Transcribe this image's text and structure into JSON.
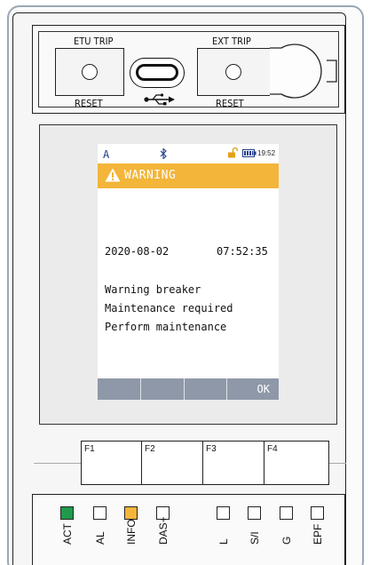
{
  "top_panel": {
    "etu_trip_label": "ETU TRIP",
    "ext_trip_label": "EXT TRIP",
    "reset_label_left": "RESET",
    "reset_label_right": "RESET",
    "usb_icon": "usb-icon"
  },
  "screen": {
    "status": {
      "mode": "A",
      "bluetooth_icon": "bluetooth-icon",
      "lock_icon": "unlock-icon",
      "battery_icon": "battery-icon",
      "time": "19:52"
    },
    "header": {
      "icon": "warning-icon",
      "title": "WARNING",
      "color": "#f3b53a"
    },
    "date": "2020-08-02",
    "time": "07:52:35",
    "messages": [
      "Warning breaker",
      "Maintenance required",
      "Perform maintenance"
    ],
    "softkeys": [
      "",
      "",
      "",
      "OK"
    ]
  },
  "function_keys": [
    "F1",
    "F2",
    "F3",
    "F4"
  ],
  "leds": [
    {
      "label": "ACT",
      "color": "#1f9a4a"
    },
    {
      "label": "AL",
      "color": "#ffffff"
    },
    {
      "label": "INFO",
      "color": "#f3b53a"
    },
    {
      "label": "DAS+",
      "color": "#ffffff"
    },
    {
      "label": "L",
      "color": "#ffffff"
    },
    {
      "label": "S/I",
      "color": "#ffffff"
    },
    {
      "label": "G",
      "color": "#ffffff"
    },
    {
      "label": "EPF",
      "color": "#ffffff"
    }
  ]
}
